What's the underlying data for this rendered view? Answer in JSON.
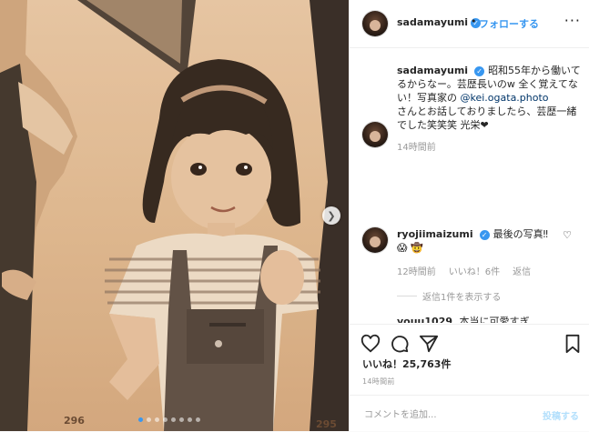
{
  "post_author": {
    "username": "sadamayumi",
    "follow_separator": "•",
    "follow_label": "フォローする"
  },
  "caption": {
    "username": "sadamayumi",
    "lines_before_mention": "昭和55年から働いてるからなー。芸歴長いのw 全く覚えてない！写真家の",
    "mention": "@kei.ogata.photo",
    "lines_after_mention": "さんとお話しておりましたら、芸歴一緒でした笑笑笑 光栄❤",
    "time": "14時間前"
  },
  "comments": [
    {
      "username": "ryojiimaizumi",
      "text": "最後の写真‼😱 🤠",
      "time": "12時間前",
      "likes": "いいね！6件",
      "reply": "返信",
      "view_replies": "返信1件を表示する"
    },
    {
      "username": "youu1029",
      "text": "本当に可愛すぎ"
    }
  ],
  "photo": {
    "page_left": "296",
    "page_right": "295",
    "slide_count": 8,
    "active_slide": 1
  },
  "stats": {
    "likes": "いいね！25,763件",
    "posted": "14時間前"
  },
  "comment_box": {
    "placeholder": "コメントを追加...",
    "post_label": "投稿する"
  },
  "colors": {
    "accent": "#3897f0",
    "post_disabled": "#b2dffc",
    "photo_tone": "#dfb990"
  }
}
